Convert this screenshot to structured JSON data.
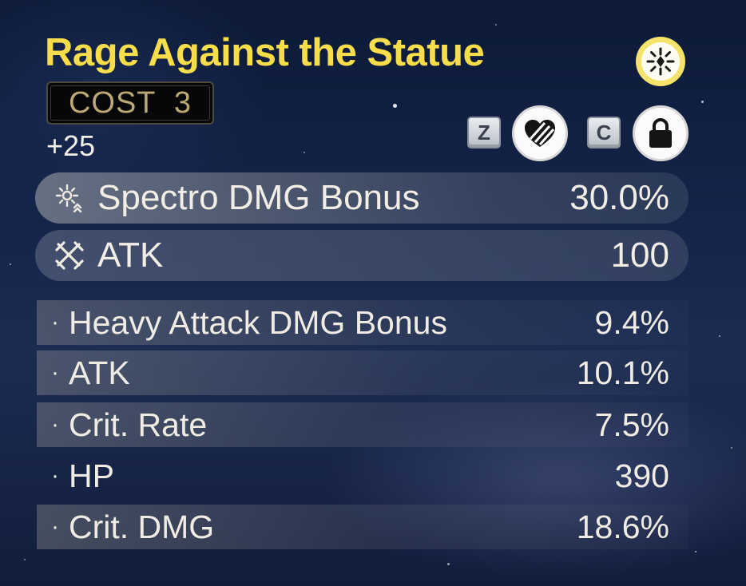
{
  "echo": {
    "title": "Rage Against the Statue",
    "cost_label": "COST  3",
    "level": "+25",
    "element_icon": "spectro-element-icon",
    "accent_color": "#f7dd4a"
  },
  "controls": {
    "favorite_key": "Z",
    "favorite_icon": "heart-broken-icon",
    "lock_key": "C",
    "lock_icon": "padlock-icon"
  },
  "main_stats": [
    {
      "icon": "spectro-bonus-icon",
      "label": "Spectro DMG Bonus",
      "value": "30.0%"
    },
    {
      "icon": "crossed-swords-icon",
      "label": "ATK",
      "value": "100"
    }
  ],
  "sub_stats": [
    {
      "label": "Heavy Attack DMG Bonus",
      "value": "9.4%"
    },
    {
      "label": "ATK",
      "value": "10.1%"
    },
    {
      "label": "Crit. Rate",
      "value": "7.5%"
    },
    {
      "label": "HP",
      "value": "390"
    },
    {
      "label": "Crit. DMG",
      "value": "18.6%"
    }
  ],
  "bullet": "·"
}
